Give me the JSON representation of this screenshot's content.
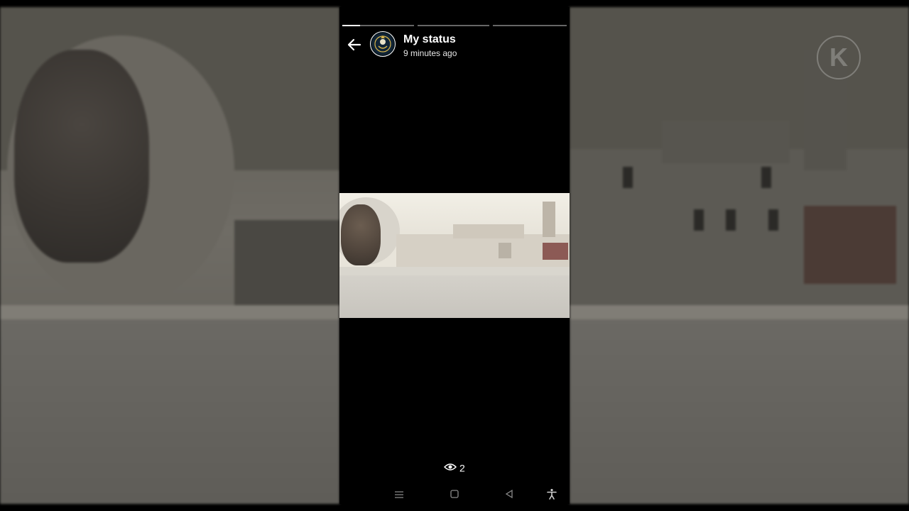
{
  "status": {
    "title": "My status",
    "time": "9 minutes ago",
    "views": "2",
    "segments": [
      0.25,
      0,
      0
    ]
  },
  "icons": {
    "back": "arrow-left-icon",
    "views": "eye-icon",
    "nav": [
      "menu-icon",
      "home-square-icon",
      "back-triangle-icon",
      "accessibility-icon"
    ]
  },
  "colors": {
    "background": "#000000",
    "text": "#ffffff",
    "nav_icon": "#8a8a8a"
  },
  "watermark": {
    "letter": "K"
  }
}
